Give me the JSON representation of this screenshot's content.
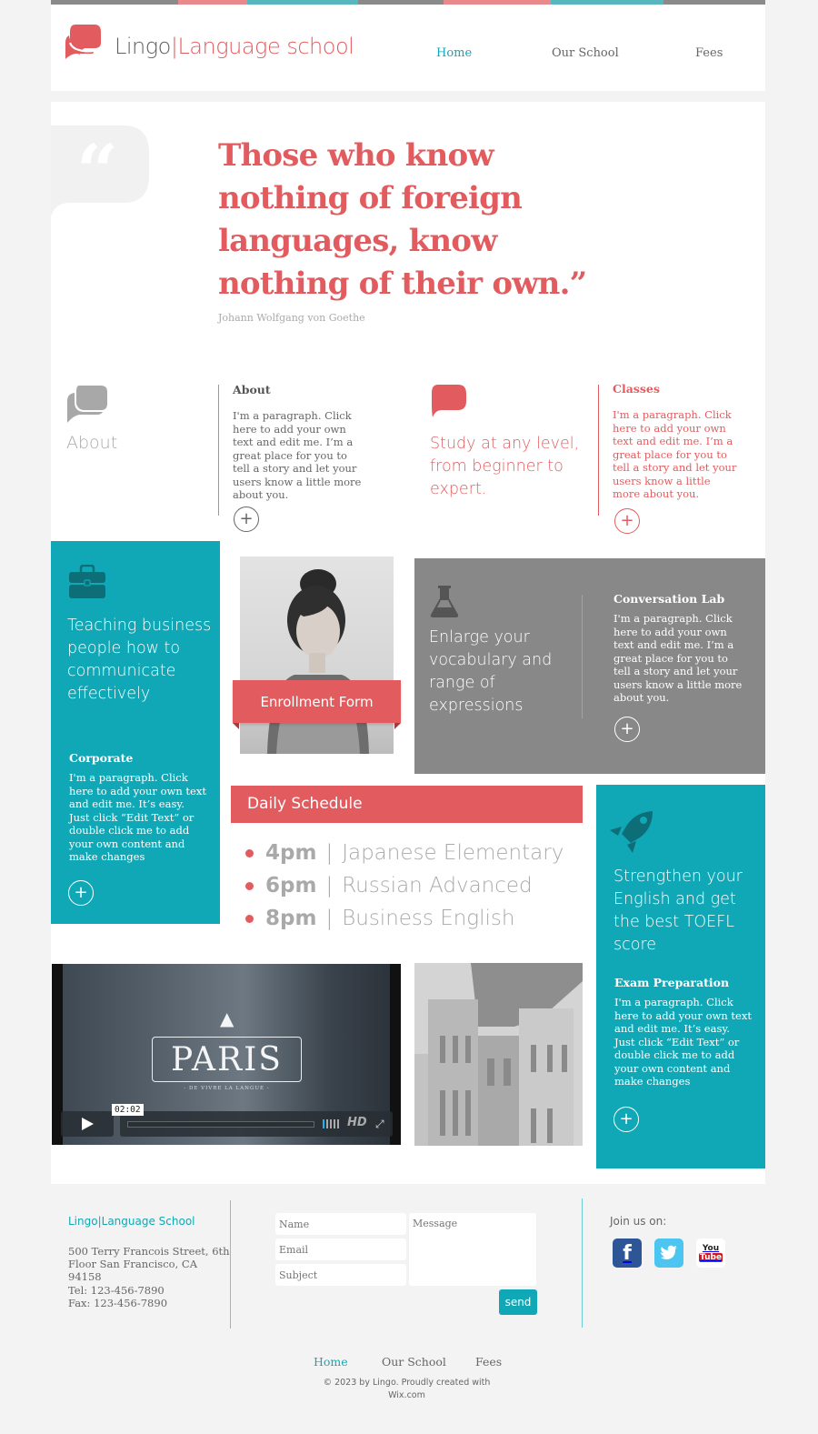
{
  "colors": {
    "accent_red": "#e25c5f",
    "accent_teal": "#10a8b6",
    "panel_gray": "#888888",
    "page_bg": "#f3f3f3"
  },
  "header": {
    "brand_name": "Lingo",
    "brand_separator": "|",
    "brand_tagline": "Language school",
    "logo_icon": "speech-bubbles-icon",
    "nav": [
      {
        "label": "Home",
        "active": true
      },
      {
        "label": "Our School",
        "active": false
      },
      {
        "label": "Fees",
        "active": false
      }
    ]
  },
  "hero": {
    "quote_icon": "quote-bubble-icon",
    "quote": "Those who know nothing of foreign languages, know nothing of their own.”",
    "author": "Johann Wolfgang von Goethe"
  },
  "about": {
    "icon": "speech-bubbles-icon",
    "section_label": "About",
    "card_title": "About",
    "card_text": "I'm a paragraph. Click here to add your own text and edit me. I’m a great place for you to tell a story and let your users know a little more about you.",
    "more_icon": "plus-circle-icon"
  },
  "classes": {
    "icon": "speech-bubble-icon",
    "tagline": "Study at any level, from beginner to expert.",
    "card_title": "Classes",
    "card_text": "I'm a paragraph. Click here to add your own text and edit me. I’m a great place for you to tell a story and let your users know a little more about you.",
    "more_icon": "plus-circle-icon"
  },
  "corporate": {
    "icon": "briefcase-icon",
    "tagline": "Teaching business people how to communicate effectively",
    "card_title": "Corporate",
    "card_text": "I'm a paragraph. Click here to add your own text and edit me. It’s easy. Just click “Edit Text” or double click me to add your own content and make changes",
    "more_icon": "plus-circle-icon"
  },
  "enrollment": {
    "photo_alt": "Woman portrait photo",
    "button_label": "Enrollment Form"
  },
  "conversation_lab": {
    "icon": "flask-icon",
    "tagline": "Enlarge your vocabulary and range of expressions",
    "card_title": "Conversation Lab",
    "card_text": "I'm a paragraph. Click here to add your own text and edit me. I’m a great place for you to tell a story and let your users know a little more about you.",
    "more_icon": "plus-circle-icon"
  },
  "schedule": {
    "title": "Daily Schedule",
    "items": [
      {
        "time": "4pm",
        "separator": "|",
        "class": "Japanese Elementary"
      },
      {
        "time": "6pm",
        "separator": "|",
        "class": "Russian Advanced"
      },
      {
        "time": "8pm",
        "separator": "|",
        "class": "Business English"
      }
    ]
  },
  "exam": {
    "icon": "rocket-icon",
    "tagline": "Strengthen your English and get the best TOEFL score",
    "card_title": "Exam Preparation",
    "card_text": "I'm a paragraph. Click here to add your own text and edit me. It’s easy. Just click “Edit Text” or double click me to add your own content and make changes",
    "more_icon": "plus-circle-icon"
  },
  "video": {
    "title_text": "PARIS",
    "subtitle_text": "- DE VIVRE LA LANGUE -",
    "time_tooltip": "02:02",
    "hd_label": "HD",
    "progress": 0
  },
  "building_photo": {
    "alt": "Building street photo"
  },
  "footer": {
    "brand": "Lingo|Language School",
    "address": "500 Terry Francois Street, 6th Floor San Francisco, CA  94158",
    "tel": "Tel: 123-456-7890",
    "fax": "Fax: 123-456-7890",
    "form": {
      "name_placeholder": "Name",
      "email_placeholder": "Email",
      "subject_placeholder": "Subject",
      "message_placeholder": "Message",
      "send_label": "send"
    },
    "join_label": "Join us on:",
    "social": [
      "facebook",
      "twitter",
      "youtube"
    ],
    "nav": [
      {
        "label": "Home",
        "active": true
      },
      {
        "label": "Our School",
        "active": false
      },
      {
        "label": "Fees",
        "active": false
      }
    ],
    "copyright": "© 2023 by Lingo. Proudly created with Wix.com"
  }
}
